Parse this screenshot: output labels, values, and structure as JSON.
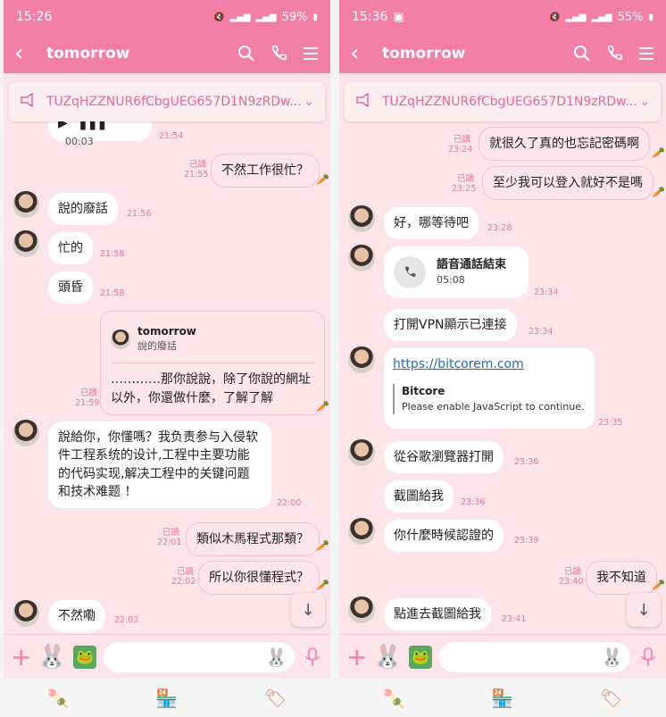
{
  "screens": [
    {
      "status": {
        "time": "15:26",
        "battery": "59%"
      },
      "header": {
        "title": "tomorrow"
      },
      "notice": {
        "text": "TUZqHZZNUR6fCbgUEG657D1N9zRDw..."
      },
      "messages": {
        "m0": {
          "time": "21:54",
          "audio_length": "00:03"
        },
        "m1": {
          "text": "不然工作很忙？",
          "read": "已讀",
          "time": "21:55"
        },
        "m2": {
          "text": "說的廢話",
          "time": "21:56"
        },
        "m3": {
          "text": "忙的",
          "time": "21:58"
        },
        "m4": {
          "text": "頭昏",
          "time": "21:58"
        },
        "m5": {
          "quote_name": "tomorrow",
          "quote_text": "說的廢話",
          "text": "…………那你說說，除了你說的網址以外，你還做什麼，了解了解",
          "read": "已讀",
          "time": "21:59"
        },
        "m6": {
          "text": "說給你，你懂嗎？我负责参与入侵软件工程系统的设计,工程中主要功能的代码实现,解决工程中的关键问题和技术难题 ！",
          "time": "22:00"
        },
        "m7": {
          "text": "類似木馬程式那類？",
          "read": "已讀",
          "time": "22:01"
        },
        "m8": {
          "text": "所以你很懂程式？",
          "read": "已讀",
          "time": "22:02"
        },
        "m9": {
          "text": "不然嘞",
          "time": "22:03"
        }
      }
    },
    {
      "status": {
        "time": "15:36",
        "battery": "55%"
      },
      "header": {
        "title": "tomorrow"
      },
      "notice": {
        "text": "TUZqHZZNUR6fCbgUEG657D1N9zRDw..."
      },
      "messages": {
        "m0": {
          "text": "就很久了真的也忘記密碼啊",
          "read": "已讀",
          "time": "23:24"
        },
        "m1": {
          "text": "至少我可以登入就好不是嗎",
          "read": "已讀",
          "time": "23:25"
        },
        "m2": {
          "text": "好，哪等待吧",
          "time": "23:28"
        },
        "m3": {
          "title": "語音通話結束",
          "duration": "05:08",
          "time": "23:34"
        },
        "m4": {
          "text": "打開VPN顯示已連接",
          "time": "23:34"
        },
        "m5": {
          "url": "https://bitcorem.com",
          "site": "Bitcore",
          "desc": "Please enable JavaScript to continue.",
          "time": "23:35"
        },
        "m6": {
          "text": "從谷歌瀏覽器打開",
          "time": "23:36"
        },
        "m7": {
          "text": "截圖給我",
          "time": "23:36"
        },
        "m8": {
          "text": "你什麼時候認證的",
          "time": "23:39"
        },
        "m9": {
          "text": "我不知道",
          "read": "已讀",
          "time": "23:40"
        },
        "m10": {
          "text": "點進去截圖給我",
          "time": "23:41"
        }
      }
    }
  ]
}
